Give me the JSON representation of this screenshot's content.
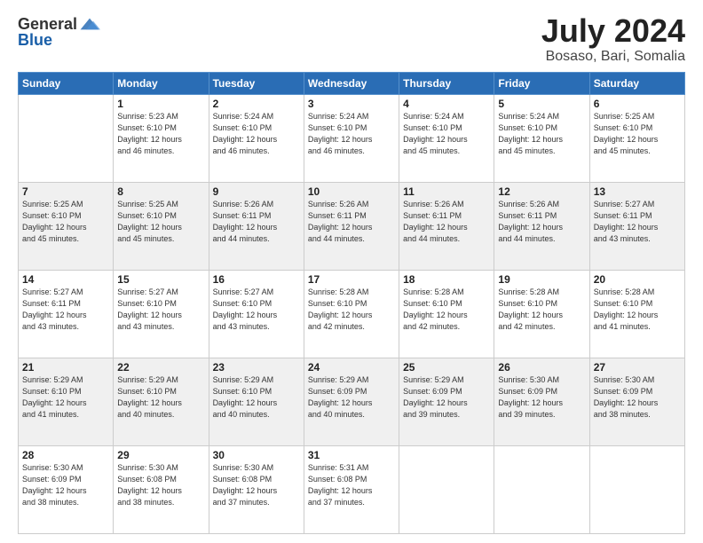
{
  "header": {
    "logo_general": "General",
    "logo_blue": "Blue",
    "month_year": "July 2024",
    "location": "Bosaso, Bari, Somalia"
  },
  "weekdays": [
    "Sunday",
    "Monday",
    "Tuesday",
    "Wednesday",
    "Thursday",
    "Friday",
    "Saturday"
  ],
  "weeks": [
    [
      {
        "day": "",
        "info": ""
      },
      {
        "day": "1",
        "info": "Sunrise: 5:23 AM\nSunset: 6:10 PM\nDaylight: 12 hours\nand 46 minutes."
      },
      {
        "day": "2",
        "info": "Sunrise: 5:24 AM\nSunset: 6:10 PM\nDaylight: 12 hours\nand 46 minutes."
      },
      {
        "day": "3",
        "info": "Sunrise: 5:24 AM\nSunset: 6:10 PM\nDaylight: 12 hours\nand 46 minutes."
      },
      {
        "day": "4",
        "info": "Sunrise: 5:24 AM\nSunset: 6:10 PM\nDaylight: 12 hours\nand 45 minutes."
      },
      {
        "day": "5",
        "info": "Sunrise: 5:24 AM\nSunset: 6:10 PM\nDaylight: 12 hours\nand 45 minutes."
      },
      {
        "day": "6",
        "info": "Sunrise: 5:25 AM\nSunset: 6:10 PM\nDaylight: 12 hours\nand 45 minutes."
      }
    ],
    [
      {
        "day": "7",
        "info": "Sunrise: 5:25 AM\nSunset: 6:10 PM\nDaylight: 12 hours\nand 45 minutes."
      },
      {
        "day": "8",
        "info": "Sunrise: 5:25 AM\nSunset: 6:10 PM\nDaylight: 12 hours\nand 45 minutes."
      },
      {
        "day": "9",
        "info": "Sunrise: 5:26 AM\nSunset: 6:11 PM\nDaylight: 12 hours\nand 44 minutes."
      },
      {
        "day": "10",
        "info": "Sunrise: 5:26 AM\nSunset: 6:11 PM\nDaylight: 12 hours\nand 44 minutes."
      },
      {
        "day": "11",
        "info": "Sunrise: 5:26 AM\nSunset: 6:11 PM\nDaylight: 12 hours\nand 44 minutes."
      },
      {
        "day": "12",
        "info": "Sunrise: 5:26 AM\nSunset: 6:11 PM\nDaylight: 12 hours\nand 44 minutes."
      },
      {
        "day": "13",
        "info": "Sunrise: 5:27 AM\nSunset: 6:11 PM\nDaylight: 12 hours\nand 43 minutes."
      }
    ],
    [
      {
        "day": "14",
        "info": "Sunrise: 5:27 AM\nSunset: 6:11 PM\nDaylight: 12 hours\nand 43 minutes."
      },
      {
        "day": "15",
        "info": "Sunrise: 5:27 AM\nSunset: 6:10 PM\nDaylight: 12 hours\nand 43 minutes."
      },
      {
        "day": "16",
        "info": "Sunrise: 5:27 AM\nSunset: 6:10 PM\nDaylight: 12 hours\nand 43 minutes."
      },
      {
        "day": "17",
        "info": "Sunrise: 5:28 AM\nSunset: 6:10 PM\nDaylight: 12 hours\nand 42 minutes."
      },
      {
        "day": "18",
        "info": "Sunrise: 5:28 AM\nSunset: 6:10 PM\nDaylight: 12 hours\nand 42 minutes."
      },
      {
        "day": "19",
        "info": "Sunrise: 5:28 AM\nSunset: 6:10 PM\nDaylight: 12 hours\nand 42 minutes."
      },
      {
        "day": "20",
        "info": "Sunrise: 5:28 AM\nSunset: 6:10 PM\nDaylight: 12 hours\nand 41 minutes."
      }
    ],
    [
      {
        "day": "21",
        "info": "Sunrise: 5:29 AM\nSunset: 6:10 PM\nDaylight: 12 hours\nand 41 minutes."
      },
      {
        "day": "22",
        "info": "Sunrise: 5:29 AM\nSunset: 6:10 PM\nDaylight: 12 hours\nand 40 minutes."
      },
      {
        "day": "23",
        "info": "Sunrise: 5:29 AM\nSunset: 6:10 PM\nDaylight: 12 hours\nand 40 minutes."
      },
      {
        "day": "24",
        "info": "Sunrise: 5:29 AM\nSunset: 6:09 PM\nDaylight: 12 hours\nand 40 minutes."
      },
      {
        "day": "25",
        "info": "Sunrise: 5:29 AM\nSunset: 6:09 PM\nDaylight: 12 hours\nand 39 minutes."
      },
      {
        "day": "26",
        "info": "Sunrise: 5:30 AM\nSunset: 6:09 PM\nDaylight: 12 hours\nand 39 minutes."
      },
      {
        "day": "27",
        "info": "Sunrise: 5:30 AM\nSunset: 6:09 PM\nDaylight: 12 hours\nand 38 minutes."
      }
    ],
    [
      {
        "day": "28",
        "info": "Sunrise: 5:30 AM\nSunset: 6:09 PM\nDaylight: 12 hours\nand 38 minutes."
      },
      {
        "day": "29",
        "info": "Sunrise: 5:30 AM\nSunset: 6:08 PM\nDaylight: 12 hours\nand 38 minutes."
      },
      {
        "day": "30",
        "info": "Sunrise: 5:30 AM\nSunset: 6:08 PM\nDaylight: 12 hours\nand 37 minutes."
      },
      {
        "day": "31",
        "info": "Sunrise: 5:31 AM\nSunset: 6:08 PM\nDaylight: 12 hours\nand 37 minutes."
      },
      {
        "day": "",
        "info": ""
      },
      {
        "day": "",
        "info": ""
      },
      {
        "day": "",
        "info": ""
      }
    ]
  ]
}
